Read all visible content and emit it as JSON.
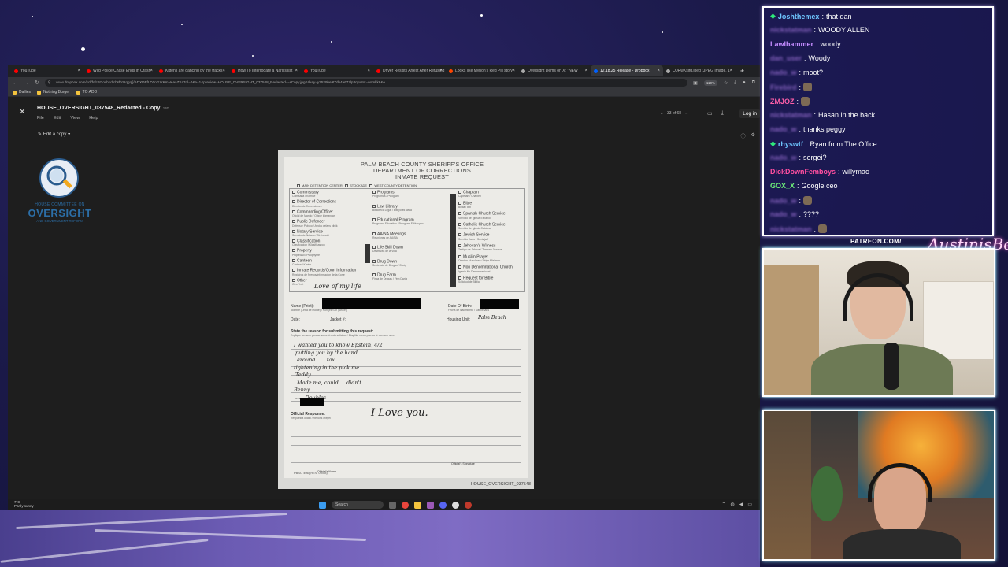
{
  "browser": {
    "tabs": [
      {
        "label": "YouTube",
        "color": "#ff0000",
        "active": false
      },
      {
        "label": "Wild Police Chase Ends in Crash",
        "color": "#ff0000",
        "active": false
      },
      {
        "label": "Kittens are dancing by the tracks",
        "color": "#ff0000",
        "active": false
      },
      {
        "label": "How To Interrogate a Narcissist",
        "color": "#ff0000",
        "active": false
      },
      {
        "label": "YouTube",
        "color": "#ff0000",
        "active": false
      },
      {
        "label": "Driver Resists Arrest After Refusing",
        "color": "#ff0000",
        "active": false
      },
      {
        "label": "Looks like Mynon's Red Pill story",
        "color": "#ff4500",
        "active": false
      },
      {
        "label": "Oversight Dems on X: \"NEW",
        "color": "#aaaaaa",
        "active": false
      },
      {
        "label": "12.18.25 Release - Dropbox",
        "color": "#0061ff",
        "active": true
      },
      {
        "label": "Q0RwKsifg.jpeg (JPEG Image, 1",
        "color": "#aaaaaa",
        "active": false
      }
    ],
    "url": "www.dropbox.com/scl/fo/c6t2ochkdtcbsfbzzqgqfj/ADXDEfLD1nGZrKmNeaaZSa7dl=0&e=1&preview=HOUSE_OVERSIGHT_037548_Redacted+-+Copy.jpg&rlkey=y7529be9t7db4a677lp3cyu8ot=nomkk6&e",
    "zoom": "110%",
    "bookmarks": [
      {
        "label": "Dailies",
        "color": "#f3c33d"
      },
      {
        "label": "Nothing Burger",
        "color": "#f3c33d"
      },
      {
        "label": "TO ADD",
        "color": "#f3c33d"
      }
    ]
  },
  "viewer": {
    "file_title": "HOUSE_OVERSIGHT_037548_Redacted - Copy",
    "file_type": "JPG",
    "menu": [
      "File",
      "Edit",
      "View",
      "Help"
    ],
    "pager": "33 of 68",
    "login": "Log in",
    "edit_copy": "Edit a copy"
  },
  "logo": {
    "line1": "HOUSE COMMITTEE ON",
    "line2": "OVERSIGHT",
    "line3": "AND GOVERNMENT REFORM"
  },
  "document": {
    "title_l1": "PALM BEACH COUNTY SHERIFF'S OFFICE",
    "title_l2": "DEPARTMENT OF CORRECTIONS",
    "title_l3": "INMATE REQUEST",
    "facilities": [
      "MAIN DETENTION CENTER",
      "STOCKADE",
      "WEST COUNTY DETENTION"
    ],
    "left_services": [
      {
        "label": "Commissary",
        "sub": "Comisaria / Komise"
      },
      {
        "label": "Director of Corrections",
        "sub": "Director de Correcciones"
      },
      {
        "label": "Commanding Officer",
        "sub": "Oficial de Mando / Ofisye kòmandan"
      },
      {
        "label": "Public Defender",
        "sub": "Defensor Publico / Avoka defans piblik"
      },
      {
        "label": "Notary Service",
        "sub": "Servicio de Notario / Sèvis notè"
      },
      {
        "label": "Classification",
        "sub": "Clasificacion / Klasifikasyon"
      },
      {
        "label": "Property",
        "sub": "Propiedad / Pwopriyete"
      },
      {
        "label": "Canteen",
        "sub": "Cantina / Kantin"
      },
      {
        "label": "Inmate Records/Court Information",
        "sub": "Registros de Presos/Informacion de la Corte"
      },
      {
        "label": "Other",
        "sub": "Otro / Lòt"
      }
    ],
    "mid_services": [
      {
        "label": "Programs",
        "sub": "Programas / Pwogram"
      },
      {
        "label": "Law Library",
        "sub": "Biblioteca Legal / Bibliyotèk lalwa"
      },
      {
        "label": "Educational Program",
        "sub": "Programa Educativo / Pwogram Edikasyon"
      },
      {
        "label": "AA/NA Meetings",
        "sub": "Reuniones de AA/NA"
      },
      {
        "label": "Life Skill Down",
        "sub": "Destrezas de la vida"
      },
      {
        "label": "Drug Down",
        "sub": "Sentencia de Drogas / Dwòg"
      },
      {
        "label": "Drug Farm",
        "sub": "Finca de Drogas / Fèm Dwòg"
      }
    ],
    "right_services": [
      {
        "label": "Chaplain",
        "sub": "Capellan / Chaplen"
      },
      {
        "label": "Bible",
        "sub": "Biblia / Bib"
      },
      {
        "label": "Spanish Church Service",
        "sub": "Servicio de Iglesia Espanol"
      },
      {
        "label": "Catholic Church Service",
        "sub": "Servicio de Iglesia Catolica"
      },
      {
        "label": "Jewish Service",
        "sub": "Servicio Judio / Sèvis jwif"
      },
      {
        "label": "Jehovah's Witness",
        "sub": "Testigo de Jehova / Temwen Jewova"
      },
      {
        "label": "Muslim Prayer",
        "sub": "Oracion Musulman / Priye Mizilman"
      },
      {
        "label": "Non Denominational Church",
        "sub": "Iglesia No Denominacional"
      },
      {
        "label": "Request for Bible",
        "sub": "Solicitud de Biblia"
      }
    ],
    "other_hw": "Love of my life",
    "field_name": "Name (Print):",
    "field_name_sub": "Nombre (Letra de molde) / Non (ekri an gwo lèt)",
    "field_dob": "Date Of Birth:",
    "field_dob_sub": "Fecha de Nacimiento / Dat nesans",
    "field_date": "Date:",
    "field_jacket": "Jacket #:",
    "field_housing": "Housing Unit:",
    "housing_hw": "Palm Beach",
    "reason_label": "State the reason for submitting this request:",
    "reason_sub": "Explique la razón porque sometió esta solicitud / Eksplike rezon pou ou fè demann sa a",
    "request_hw": [
      "I wanted you to know Epstein, 4/2",
      "putting you by the hand",
      "around ..... tax",
      "tightening in the pick me",
      "Teddy ......",
      "Made me, could ... didn't",
      "Benny ......",
      "..... Doubles"
    ],
    "response_label": "Official Response:",
    "response_sub": "Respuesta oficial / Repons ofisyèl",
    "response_hw": "I Love you.",
    "signature_label": "Official's Name",
    "signature_label2": "Official's Signature",
    "form_no": "PBSO 406 (REV. 09/08)",
    "footer_id": "HOUSE_OVERSIGHT_037548"
  },
  "taskbar": {
    "weather_temp": "7°C",
    "weather_desc": "Partly sunny",
    "search": "Search"
  },
  "chat": [
    {
      "user": "Joshthemex",
      "color": "#6ec6ff",
      "badge": true,
      "msg": "that dan",
      "blur": false
    },
    {
      "user": "nickstatman",
      "color": "#c48cff",
      "badge": false,
      "msg": "WOODY ALLEN",
      "blur": true
    },
    {
      "user": "Lawlhammer",
      "color": "#c48cff",
      "badge": false,
      "msg": "woody",
      "blur": false
    },
    {
      "user": "dan_user",
      "color": "#c48cff",
      "badge": false,
      "msg": "Woody",
      "blur": true
    },
    {
      "user": "nado_w",
      "color": "#c48cff",
      "badge": false,
      "msg": "moot?",
      "blur": true
    },
    {
      "user": "Firebird",
      "color": "#c48cff",
      "badge": false,
      "msg": "",
      "blur": true
    },
    {
      "user": "ZMJOZ",
      "color": "#ff5fa8",
      "badge": false,
      "msg": "",
      "blur": false
    },
    {
      "user": "nickstatman",
      "color": "#c48cff",
      "badge": false,
      "msg": "Hasan in the back",
      "blur": true
    },
    {
      "user": "nado_w",
      "color": "#c48cff",
      "badge": false,
      "msg": "thanks peggy",
      "blur": true
    },
    {
      "user": "rhyswtf",
      "color": "#6ec6ff",
      "badge": true,
      "msg": "Ryan from The Office",
      "blur": false
    },
    {
      "user": "nado_w",
      "color": "#c48cff",
      "badge": false,
      "msg": "sergei?",
      "blur": true
    },
    {
      "user": "DickDownFemboys",
      "color": "#ff4fa0",
      "badge": false,
      "msg": "willymac",
      "blur": false
    },
    {
      "user": "GOX_X",
      "color": "#6ef07a",
      "badge": false,
      "msg": "Google ceo",
      "blur": false
    },
    {
      "user": "nado_w",
      "color": "#c48cff",
      "badge": false,
      "msg": "",
      "blur": true
    },
    {
      "user": "nado_w",
      "color": "#c48cff",
      "badge": false,
      "msg": "????",
      "blur": true
    },
    {
      "user": "nickstatman",
      "color": "#c48cff",
      "badge": false,
      "msg": "",
      "blur": true
    }
  ],
  "overlay": {
    "patreon": "PATREON.COM/",
    "script": "AustinisBebe"
  }
}
